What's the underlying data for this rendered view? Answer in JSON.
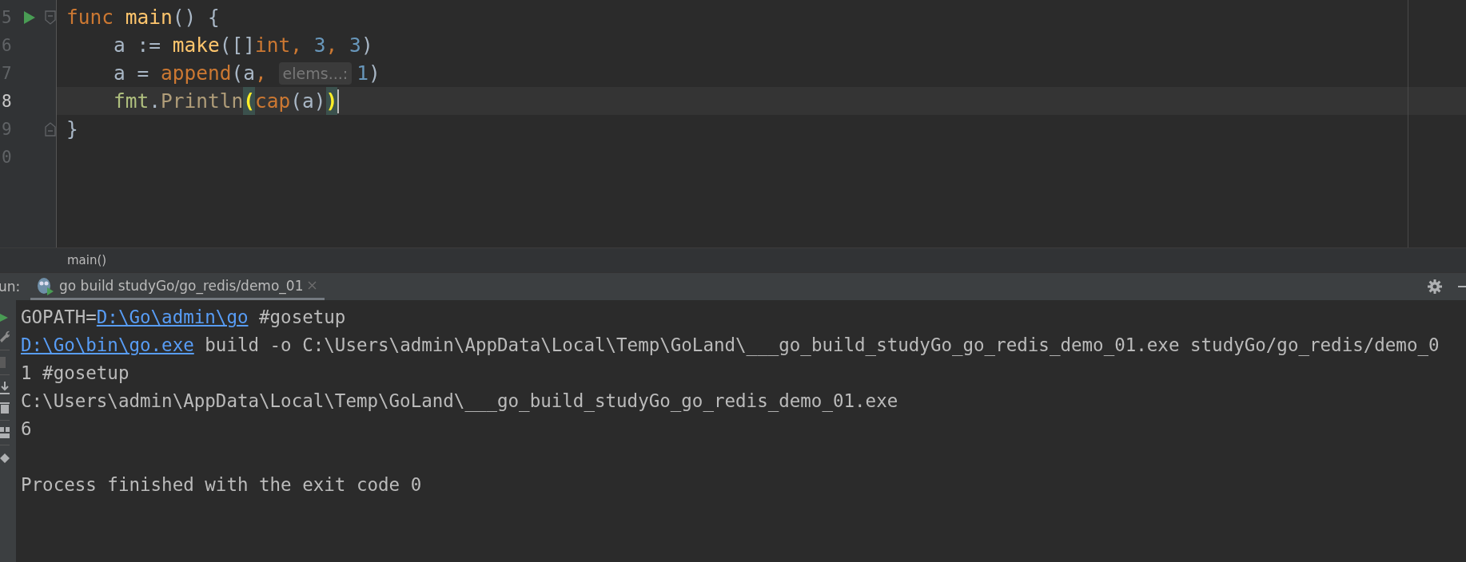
{
  "editor": {
    "lines": [
      {
        "number": "5",
        "run_marker": true,
        "fold_start": true,
        "fold_end": false,
        "current": false,
        "tokens": [
          {
            "kind": "keyword",
            "text": "func "
          },
          {
            "kind": "funcname",
            "text": "main"
          },
          {
            "kind": "plain",
            "text": "() {"
          }
        ]
      },
      {
        "number": "6",
        "run_marker": false,
        "fold_start": false,
        "fold_end": false,
        "current": false,
        "tokens": [
          {
            "kind": "plain",
            "text": "    a := "
          },
          {
            "kind": "builtin",
            "text": "make"
          },
          {
            "kind": "plain",
            "text": "([]"
          },
          {
            "kind": "keyword",
            "text": "int"
          },
          {
            "kind": "keyword",
            "text": ", "
          },
          {
            "kind": "number",
            "text": "3"
          },
          {
            "kind": "keyword",
            "text": ", "
          },
          {
            "kind": "number",
            "text": "3"
          },
          {
            "kind": "plain",
            "text": ")"
          }
        ]
      },
      {
        "number": "7",
        "run_marker": false,
        "fold_start": false,
        "fold_end": false,
        "current": false,
        "tokens": [
          {
            "kind": "plain",
            "text": "    a = "
          },
          {
            "kind": "call",
            "text": "append"
          },
          {
            "kind": "plain",
            "text": "(a"
          },
          {
            "kind": "keyword",
            "text": ", "
          },
          {
            "kind": "hint",
            "text": "elems...:"
          },
          {
            "kind": "number",
            "text": "1"
          },
          {
            "kind": "plain",
            "text": ")"
          }
        ]
      },
      {
        "number": "8",
        "run_marker": false,
        "fold_start": false,
        "fold_end": false,
        "current": true,
        "tokens": [
          {
            "kind": "package",
            "text": "    fmt"
          },
          {
            "kind": "plain",
            "text": "."
          },
          {
            "kind": "method",
            "text": "Println"
          },
          {
            "kind": "match",
            "text": "("
          },
          {
            "kind": "call",
            "text": "cap"
          },
          {
            "kind": "plain",
            "text": "(a)"
          },
          {
            "kind": "match",
            "text": ")"
          },
          {
            "kind": "caret"
          }
        ]
      },
      {
        "number": "9",
        "run_marker": false,
        "fold_start": false,
        "fold_end": true,
        "current": false,
        "tokens": [
          {
            "kind": "plain",
            "text": "}"
          }
        ]
      },
      {
        "number": "0",
        "run_marker": false,
        "fold_start": false,
        "fold_end": false,
        "current": false
      }
    ]
  },
  "breadcrumb": "main()",
  "run_panel": {
    "label": "un:",
    "tab": {
      "title": "go build studyGo/go_redis/demo_01",
      "selected": true
    },
    "console": [
      {
        "blank_before": false,
        "segments": [
          {
            "kind": "text",
            "text": "GOPATH="
          },
          {
            "kind": "link",
            "text": "D:\\Go\\admin\\go"
          },
          {
            "kind": "text",
            "text": " #gosetup"
          }
        ]
      },
      {
        "blank_before": false,
        "segments": [
          {
            "kind": "link",
            "text": "D:\\Go\\bin\\go.exe"
          },
          {
            "kind": "text",
            "text": " build -o C:\\Users\\admin\\AppData\\Local\\Temp\\GoLand\\___go_build_studyGo_go_redis_demo_01.exe studyGo/go_redis/demo_0"
          }
        ]
      },
      {
        "blank_before": false,
        "segments": [
          {
            "kind": "text",
            "text": "1 #gosetup"
          }
        ]
      },
      {
        "blank_before": false,
        "segments": [
          {
            "kind": "text",
            "text": "C:\\Users\\admin\\AppData\\Local\\Temp\\GoLand\\___go_build_studyGo_go_redis_demo_01.exe"
          }
        ]
      },
      {
        "blank_before": false,
        "segments": [
          {
            "kind": "text",
            "text": "6"
          }
        ]
      },
      {
        "blank_before": true,
        "segments": [
          {
            "kind": "text",
            "text": "Process finished with the exit code 0"
          }
        ]
      }
    ]
  }
}
